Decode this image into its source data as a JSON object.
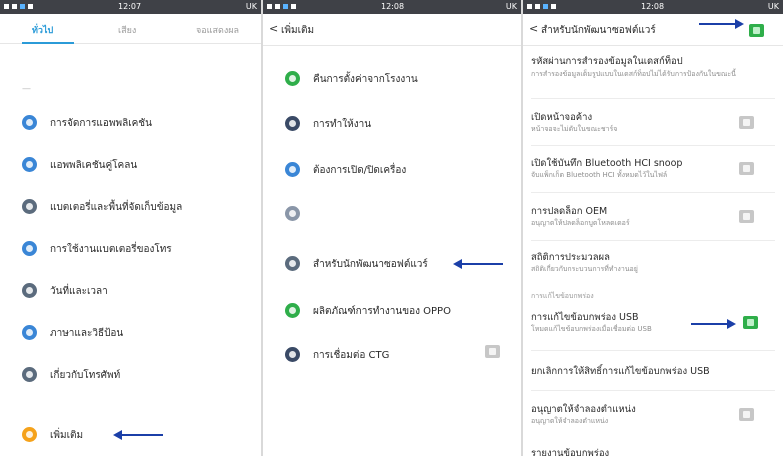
{
  "status": {
    "time_1": "12:07",
    "time_2": "12:08",
    "time_3": "12:08",
    "right_text": "UK"
  },
  "panel1": {
    "tabs": [
      {
        "label": "ทั่วไป"
      },
      {
        "label": "เสียง"
      },
      {
        "label": "จอแสดงผล"
      }
    ],
    "dashes": "—",
    "items": [
      {
        "label": "การจัดการแอพพลิเคชัน",
        "color": "#3a86d6"
      },
      {
        "label": "แอพพลิเคชันคู่โคลน",
        "color": "#3a86d6"
      },
      {
        "label": "แบตเตอรี่และพื้นที่จัดเก็บข้อมูล",
        "color": "#5b6b7d"
      },
      {
        "label": "การใช้งานแบตเตอรี่ของโทร",
        "color": "#3a86d6"
      },
      {
        "label": "วันที่และเวลา",
        "color": "#5b6b7d"
      },
      {
        "label": "ภาษาและวิธีป้อน",
        "color": "#3a86d6"
      },
      {
        "label": "เกี่ยวกับโทรศัพท์",
        "color": "#5b6b7d"
      },
      {
        "label": "เพิ่มเติม",
        "color": "#f5a21b"
      }
    ]
  },
  "panel2": {
    "back_glyph": "<",
    "title": "เพิ่มเติม",
    "items": [
      {
        "label": "คืนการตั้งค่าจากโรงงาน",
        "color": "#2fae4a"
      },
      {
        "label": "การทำให้งาน",
        "color": "#3a4a66"
      },
      {
        "label": "ต้องการเปิด/ปิดเครื่อง",
        "color": "#3a86d6"
      },
      {
        "label": "",
        "color": "#8a96a8"
      },
      {
        "label": "สำหรับนักพัฒนาซอฟต์แวร์",
        "color": "#5b6b7d"
      },
      {
        "label": "ผลิตภัณฑ์การทำงานของ OPPO",
        "color": "#2fae4a"
      },
      {
        "label": "การเชื่อมต่อ CTG",
        "color": "#3a4a66"
      }
    ]
  },
  "panel3": {
    "back_glyph": "<",
    "title": "สำหรับนักพัฒนาซอฟต์แวร์",
    "items": [
      {
        "label": "รหัสผ่านการสำรองข้อมูลในเดสก์ท็อป",
        "sub": "การสำรองข้อมูลเต็มรูปแบบในเดสก์ท็อปไม่ได้รับการป้องกันในขณะนี้",
        "toggle": ""
      },
      {
        "label": "เปิดหน้าจอค้าง",
        "sub": "หน้าจอจะไม่ดับในขณะชาร์จ",
        "toggle": "off"
      },
      {
        "label": "เปิดใช้บันทึก Bluetooth HCI snoop",
        "sub": "จับแพ็กเก็ต Bluetooth HCI ทั้งหมดไว้ในไฟล์",
        "toggle": "off"
      },
      {
        "label": "การปลดล็อก OEM",
        "sub": "อนุญาตให้ปลดล็อกบูตโหลดเดอร์",
        "toggle": "off"
      },
      {
        "label": "สถิติการประมวลผล",
        "sub": "สถิติเกี่ยวกับกระบวนการที่ทำงานอยู่",
        "toggle": ""
      },
      {
        "label": "การแก้ไขข้อบกพร่อง USB",
        "sub": "โหมดแก้ไขข้อบกพร่องเมื่อเชื่อมต่อ USB",
        "toggle": "on"
      },
      {
        "label": "ยกเลิกการให้สิทธิ์การแก้ไขข้อบกพร่อง USB",
        "sub": "",
        "toggle": ""
      },
      {
        "label": "อนุญาตให้จำลองตำแหน่ง",
        "sub": "อนุญาตให้จำลองตำแหน่ง",
        "toggle": "off"
      },
      {
        "label": "รายงานข้อบกพร่อง",
        "sub": "",
        "toggle": ""
      }
    ],
    "section_caption": "การแก้ไขข้อบกพร่อง",
    "header_toggle": "on"
  },
  "colors": {
    "accent_tab": "#2b9bd8",
    "arrow": "#1b3fa8",
    "toggle_on": "#2fae4a",
    "toggle_off": "#c7c7c7"
  }
}
